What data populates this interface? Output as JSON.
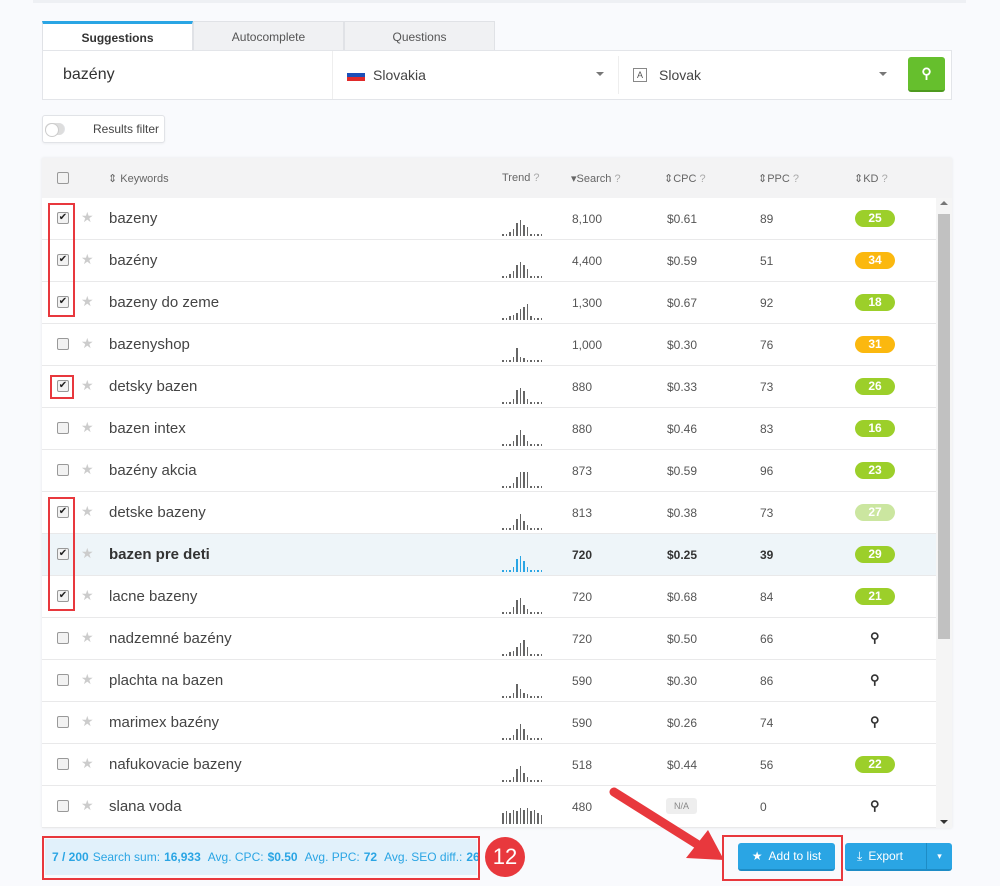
{
  "tabs": [
    {
      "label": "Suggestions",
      "active": true
    },
    {
      "label": "Autocomplete"
    },
    {
      "label": "Questions"
    }
  ],
  "search": {
    "keyword": "bazény",
    "country": "Slovakia",
    "language": "Slovak"
  },
  "filter_label": "Results filter",
  "columns": {
    "keywords": "Keywords",
    "trend": "Trend",
    "search": "Search",
    "cpc": "CPC",
    "ppc": "PPC",
    "kd": "KD"
  },
  "colors": {
    "accent": "#2aa5e4",
    "kd_green": "#9acd32",
    "kd_orange": "#fbb80f",
    "kd_light": "#cbe6a0",
    "annotation": "#e8383d"
  },
  "rows": [
    {
      "kw": "bazeny",
      "search": "8,100",
      "cpc": "$0.61",
      "ppc": "89",
      "kd": "25",
      "kdc": "#9ccf2a",
      "checked": true,
      "trend": [
        1,
        1,
        2,
        4,
        7,
        9,
        6,
        5,
        1,
        1,
        1,
        1
      ]
    },
    {
      "kw": "bazény",
      "search": "4,400",
      "cpc": "$0.59",
      "ppc": "51",
      "kd": "34",
      "kdc": "#fbb80f",
      "checked": true,
      "trend": [
        1,
        1,
        2,
        4,
        7,
        9,
        7,
        5,
        1,
        1,
        1,
        1
      ]
    },
    {
      "kw": "bazeny do zeme",
      "search": "1,300",
      "cpc": "$0.67",
      "ppc": "92",
      "kd": "18",
      "kdc": "#9ccf2a",
      "checked": true,
      "trend": [
        1,
        1,
        2,
        3,
        4,
        6,
        7,
        9,
        2,
        1,
        1,
        1
      ]
    },
    {
      "kw": "bazenyshop",
      "search": "1,000",
      "cpc": "$0.30",
      "ppc": "76",
      "kd": "31",
      "kdc": "#fbb80f",
      "checked": false,
      "trend": [
        1,
        1,
        1,
        3,
        8,
        3,
        2,
        1,
        1,
        1,
        1,
        1
      ]
    },
    {
      "kw": "detsky bazen",
      "search": "880",
      "cpc": "$0.33",
      "ppc": "73",
      "kd": "26",
      "kdc": "#9ccf2a",
      "checked": true,
      "trend": [
        1,
        1,
        1,
        3,
        8,
        9,
        7,
        3,
        1,
        1,
        1,
        1
      ]
    },
    {
      "kw": "bazen intex",
      "search": "880",
      "cpc": "$0.46",
      "ppc": "83",
      "kd": "16",
      "kdc": "#9ccf2a",
      "checked": false,
      "trend": [
        1,
        1,
        1,
        3,
        6,
        9,
        6,
        3,
        1,
        1,
        1,
        1
      ]
    },
    {
      "kw": "bazény akcia",
      "search": "873",
      "cpc": "$0.59",
      "ppc": "96",
      "kd": "23",
      "kdc": "#9ccf2a",
      "checked": false,
      "trend": [
        1,
        1,
        1,
        3,
        6,
        9,
        9,
        9,
        1,
        1,
        1,
        1
      ]
    },
    {
      "kw": "detske bazeny",
      "search": "813",
      "cpc": "$0.38",
      "ppc": "73",
      "kd": "27",
      "kdc": "#cbe6a0",
      "checked": true,
      "trend": [
        1,
        1,
        1,
        3,
        6,
        9,
        5,
        3,
        1,
        1,
        1,
        1
      ]
    },
    {
      "kw": "bazen pre deti",
      "search": "720",
      "cpc": "$0.25",
      "ppc": "39",
      "kd": "29",
      "kdc": "#9ccf2a",
      "checked": true,
      "hl": true,
      "trend": [
        1,
        1,
        1,
        3,
        7,
        9,
        6,
        3,
        1,
        1,
        1,
        1
      ]
    },
    {
      "kw": "lacne bazeny",
      "search": "720",
      "cpc": "$0.68",
      "ppc": "84",
      "kd": "21",
      "kdc": "#9ccf2a",
      "checked": true,
      "trend": [
        1,
        1,
        1,
        4,
        8,
        9,
        5,
        3,
        1,
        1,
        1,
        1
      ]
    },
    {
      "kw": "nadzemné bazény",
      "search": "720",
      "cpc": "$0.50",
      "ppc": "66",
      "kd": null,
      "checked": false,
      "trend": [
        1,
        1,
        2,
        3,
        5,
        7,
        9,
        5,
        1,
        1,
        1,
        1
      ]
    },
    {
      "kw": "plachta na bazen",
      "search": "590",
      "cpc": "$0.30",
      "ppc": "86",
      "kd": null,
      "checked": false,
      "trend": [
        1,
        1,
        1,
        3,
        8,
        5,
        3,
        2,
        1,
        1,
        1,
        1
      ]
    },
    {
      "kw": "marimex bazény",
      "search": "590",
      "cpc": "$0.26",
      "ppc": "74",
      "kd": null,
      "checked": false,
      "trend": [
        1,
        1,
        1,
        3,
        6,
        9,
        6,
        3,
        1,
        1,
        1,
        1
      ]
    },
    {
      "kw": "nafukovacie bazeny",
      "search": "518",
      "cpc": "$0.44",
      "ppc": "56",
      "kd": "22",
      "kdc": "#9ccf2a",
      "checked": false,
      "trend": [
        1,
        1,
        1,
        3,
        7,
        9,
        5,
        3,
        1,
        1,
        1,
        1
      ]
    },
    {
      "kw": "slana voda",
      "search": "480",
      "cpc": "N/A",
      "ppc": "0",
      "kd": null,
      "checked": false,
      "trend": [
        6,
        7,
        6,
        8,
        7,
        9,
        8,
        9,
        7,
        8,
        6,
        5
      ]
    }
  ],
  "footer": {
    "count": "7 / 200",
    "search_label": "Search sum:",
    "search_sum": "16,933",
    "cpc_label": "Avg. CPC:",
    "cpc": "$0.50",
    "ppc_label": "Avg. PPC:",
    "ppc": "72",
    "seo_label": "Avg. SEO diff.:",
    "seo": "26"
  },
  "annotation_number": "12",
  "buttons": {
    "add": "Add to list",
    "export": "Export"
  }
}
